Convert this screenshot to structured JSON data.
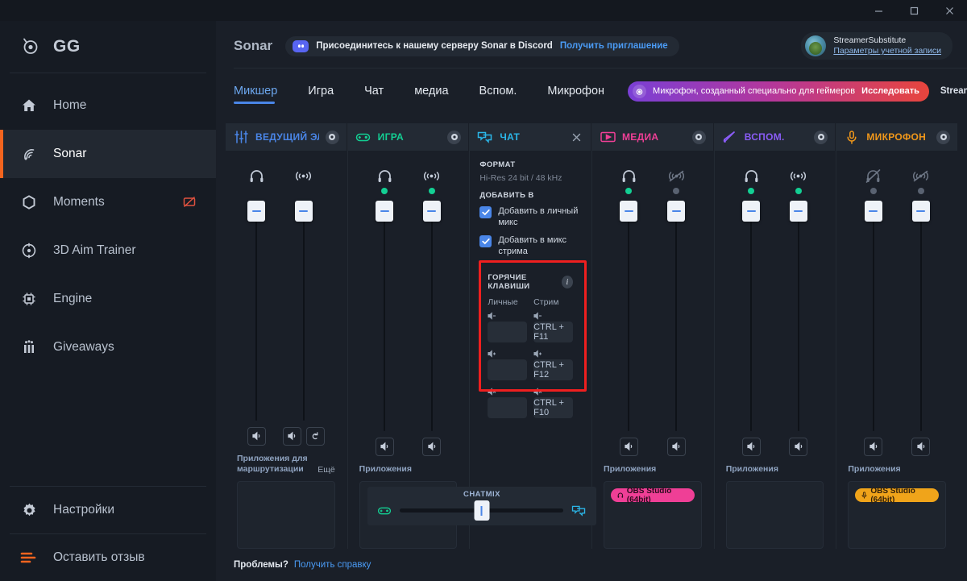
{
  "titlebar": {
    "minimize": "−",
    "maximize": "▢",
    "close": "✕"
  },
  "sidebar": {
    "brand": "GG",
    "items": [
      {
        "label": "Home",
        "icon": "home-icon"
      },
      {
        "label": "Sonar",
        "icon": "sonar-icon"
      },
      {
        "label": "Moments",
        "icon": "hexagon-icon",
        "badge": "record-off-icon"
      },
      {
        "label": "3D Aim Trainer",
        "icon": "target-icon"
      },
      {
        "label": "Engine",
        "icon": "chip-icon"
      },
      {
        "label": "Giveaways",
        "icon": "gift-icon"
      }
    ],
    "bottom_items": [
      {
        "label": "Настройки",
        "icon": "gear-icon"
      },
      {
        "label": "Оставить отзыв",
        "icon": "feedback-icon"
      }
    ]
  },
  "header": {
    "title": "Sonar",
    "discord": {
      "icon": "discord-icon",
      "text": "Присоединитесь к нашему серверу Sonar в Discord",
      "link": "Получить приглашение"
    },
    "account": {
      "name": "StreamerSubstitute",
      "link": "Параметры учетной записи",
      "avatar": "avatar"
    }
  },
  "tabs": [
    {
      "label": "Микшер",
      "active": true
    },
    {
      "label": "Игра",
      "active": false
    },
    {
      "label": "Чат",
      "active": false
    },
    {
      "label": "медиа",
      "active": false
    },
    {
      "label": "Вспом.",
      "active": false
    },
    {
      "label": "Микрофон",
      "active": false
    }
  ],
  "promo": {
    "icon": "steelseries-icon",
    "text": "Микрофон, созданный специально для геймеров",
    "cta": "Исследовать"
  },
  "streamer_mode": {
    "label": "Streamer mode",
    "info": "i",
    "enabled": true
  },
  "columns": [
    {
      "key": "master",
      "title": "ВЕДУЩИЙ ЭЛЕМЕІ",
      "color": "#4a86e8",
      "icon": "sliders-icon",
      "gear": true,
      "close": false,
      "faders": [
        {
          "icon": "headphones-icon",
          "muted": false,
          "dot": "none",
          "buttons": [
            "speaker-icon"
          ]
        },
        {
          "icon": "stream-icon",
          "muted": false,
          "dot": "none",
          "buttons": [
            "speaker-icon",
            "undo-icon"
          ]
        }
      ],
      "apps_label": "Приложения для маршрутизации",
      "apps_more": "Ещё",
      "apps": []
    },
    {
      "key": "game",
      "title": "ИГРА",
      "color": "#13cf93",
      "icon": "gamepad-icon",
      "gear": true,
      "close": false,
      "faders": [
        {
          "icon": "headphones-icon",
          "muted": false,
          "dot": "on",
          "buttons": [
            "speaker-icon"
          ]
        },
        {
          "icon": "stream-icon",
          "muted": false,
          "dot": "on",
          "buttons": [
            "speaker-icon"
          ]
        }
      ],
      "apps_label": "Приложения",
      "apps_more": "",
      "apps": []
    },
    {
      "key": "chat",
      "title": "ЧАТ",
      "color": "#2bb6e8",
      "icon": "chat-icon",
      "gear": false,
      "close": true,
      "settings": {
        "format_label": "ФОРМАТ",
        "format_value": "Hi-Res 24 bit / 48 kHz",
        "addto_label": "ДОБАВИТЬ В",
        "checkboxes": [
          {
            "label": "Добавить в личный микс",
            "checked": true
          },
          {
            "label": "Добавить в микс стрима",
            "checked": true
          }
        ],
        "hotkeys": {
          "title": "ГОРЯЧИЕ КЛАВИШИ",
          "info": "i",
          "col_personal": "Личные",
          "col_stream": "Стрим",
          "rows": [
            {
              "icon": "volume-down-icon",
              "personal": "",
              "stream": "CTRL + F11"
            },
            {
              "icon": "volume-up-icon",
              "personal": "",
              "stream": "CTRL + F12"
            },
            {
              "icon": "volume-mute-icon",
              "personal": "",
              "stream": "CTRL + F10"
            }
          ]
        }
      }
    },
    {
      "key": "media",
      "title": "МЕДИА",
      "color": "#ef3f96",
      "icon": "media-icon",
      "gear": true,
      "close": false,
      "faders": [
        {
          "icon": "headphones-icon",
          "muted": false,
          "dot": "on",
          "buttons": [
            "speaker-icon"
          ]
        },
        {
          "icon": "stream-icon",
          "muted": true,
          "dot": "off",
          "buttons": [
            "speaker-icon"
          ]
        }
      ],
      "apps_label": "Приложения",
      "apps_more": "",
      "apps": [
        {
          "label": "OBS Studio (64bit)",
          "icon": "headphones-icon",
          "color": "pink"
        }
      ]
    },
    {
      "key": "aux",
      "title": "ВСПОМ.",
      "color": "#8a5cf6",
      "icon": "aux-icon",
      "gear": true,
      "close": false,
      "faders": [
        {
          "icon": "headphones-icon",
          "muted": false,
          "dot": "on",
          "buttons": [
            "speaker-icon"
          ]
        },
        {
          "icon": "stream-icon",
          "muted": false,
          "dot": "on",
          "buttons": [
            "speaker-icon"
          ]
        }
      ],
      "apps_label": "Приложения",
      "apps_more": "",
      "apps": []
    },
    {
      "key": "mic",
      "title": "МИКРОФОН",
      "color": "#f0971a",
      "icon": "mic-icon",
      "gear": true,
      "close": false,
      "faders": [
        {
          "icon": "headphones-icon",
          "muted": true,
          "dot": "off",
          "buttons": [
            "speaker-icon"
          ]
        },
        {
          "icon": "stream-icon",
          "muted": true,
          "dot": "off",
          "buttons": [
            "speaker-icon"
          ]
        }
      ],
      "apps_label": "Приложения",
      "apps_more": "",
      "apps": [
        {
          "label": "OBS Studio (64bit)",
          "icon": "mic-icon",
          "color": "orange"
        }
      ]
    }
  ],
  "chatmix": {
    "label": "CHATMIX",
    "left_icon": "gamepad-icon",
    "right_icon": "chat-icon",
    "value": 50
  },
  "footer": {
    "question": "Проблемы?",
    "link": "Получить справку"
  }
}
